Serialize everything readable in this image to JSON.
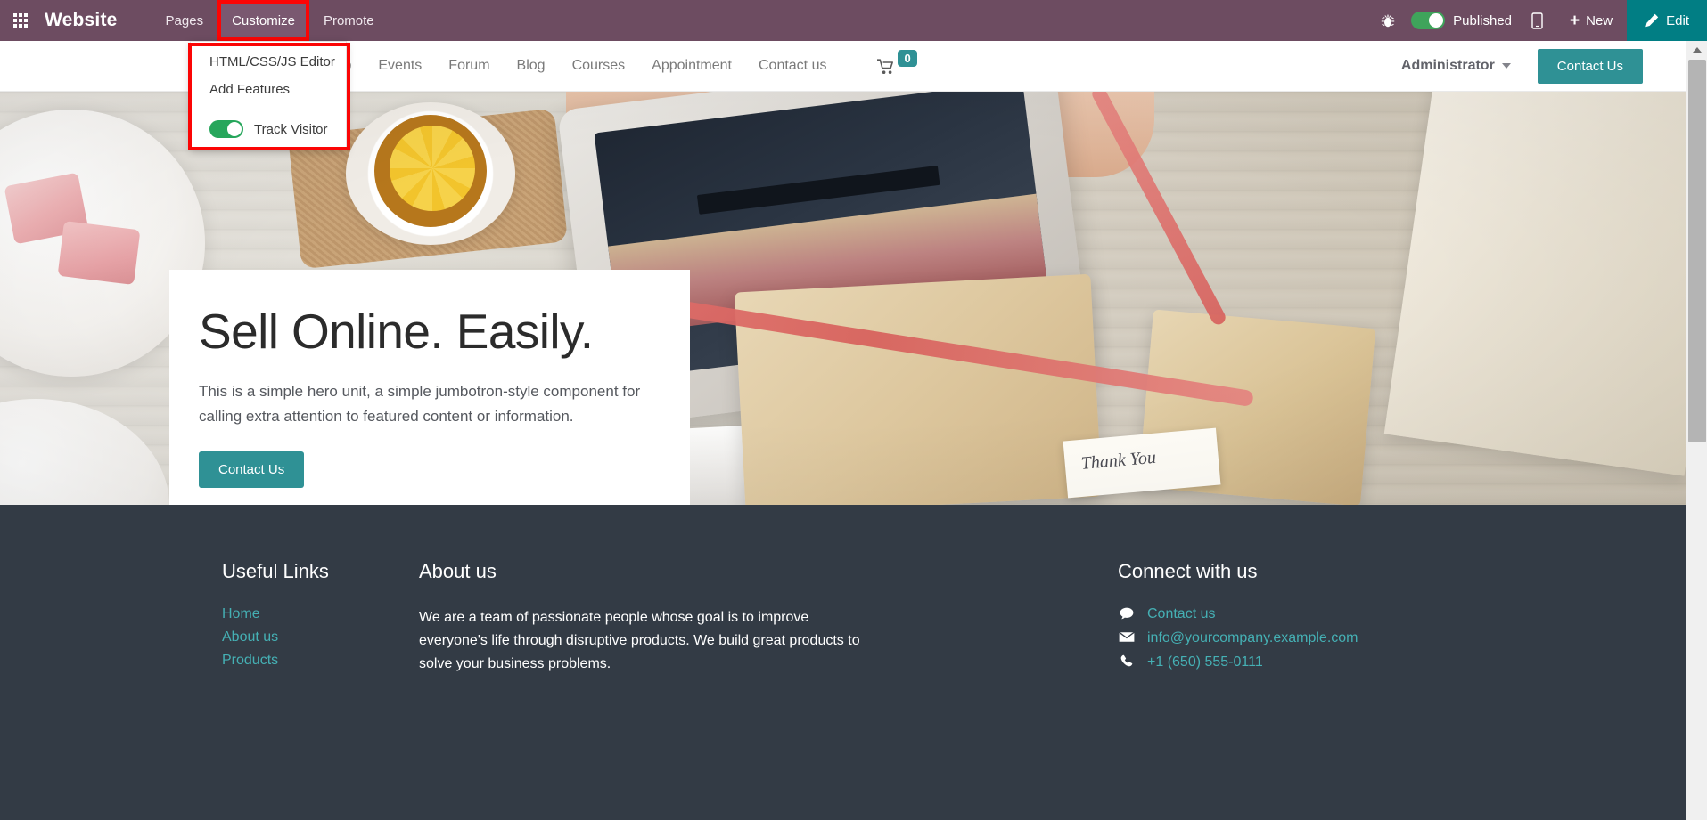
{
  "systray": {
    "apps_icon": "apps-grid-icon",
    "brand": "Website",
    "menu": [
      {
        "label": "Pages",
        "active": false
      },
      {
        "label": "Customize",
        "active": true
      },
      {
        "label": "Promote",
        "active": false
      }
    ],
    "debug_icon": "bug-icon",
    "published_label": "Published",
    "published_state": "on",
    "mobile_icon": "mobile-preview-icon",
    "new_label": "New",
    "new_icon": "plus-icon",
    "edit_label": "Edit",
    "edit_icon": "pencil-icon",
    "bar_color": "#6d4c61",
    "edit_color": "#017e84",
    "highlight_color": "#fb0505"
  },
  "customize_dropdown": {
    "items": [
      {
        "label": "HTML/CSS/JS Editor"
      },
      {
        "label": "Add Features"
      }
    ],
    "toggle": {
      "label": "Track Visitor",
      "state": "on",
      "color": "#26a65b"
    }
  },
  "site_nav": {
    "logo": "site-logo",
    "links": [
      "Shop",
      "Events",
      "Forum",
      "Blog",
      "Courses",
      "Appointment",
      "Contact us"
    ],
    "cart": {
      "icon": "shopping-cart-icon",
      "count": "0"
    },
    "user": {
      "name": "Administrator",
      "caret": "chevron-down-icon"
    },
    "cta_label": "Contact Us",
    "accent_color": "#2f9195"
  },
  "hero": {
    "title": "Sell Online. Easily.",
    "subtitle": "This is a simple hero unit, a simple jumbotron-style component for calling extra attention to featured content or information.",
    "button_label": "Contact Us",
    "tag_text": "Thank You"
  },
  "footer": {
    "columns": [
      {
        "title": "Useful Links",
        "links": [
          "Home",
          "About us",
          "Products"
        ]
      },
      {
        "title": "About us",
        "text": "We are a team of passionate people whose goal is to improve everyone's life through disruptive products. We build great products to solve your business problems."
      },
      {
        "title": "Connect with us",
        "contacts": [
          {
            "icon": "chat-bubble-icon",
            "label": "Contact us"
          },
          {
            "icon": "envelope-icon",
            "label": "info@yourcompany.example.com"
          },
          {
            "icon": "phone-icon",
            "label": "+1 (650) 555-0111"
          }
        ]
      }
    ],
    "bg_color": "#333b45",
    "link_color": "#45b0b4"
  },
  "scrollbar": {
    "up_arrow": "scroll-up-arrow",
    "thumb": "scroll-thumb"
  }
}
